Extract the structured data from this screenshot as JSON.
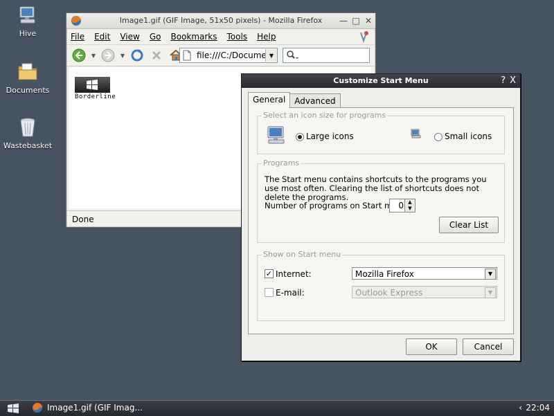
{
  "desktop": {
    "icons": [
      {
        "label": "Hive",
        "icon": "computer-icon"
      },
      {
        "label": "Documents",
        "icon": "folder-icon"
      },
      {
        "label": "Wastebasket",
        "icon": "trash-icon"
      }
    ]
  },
  "firefox": {
    "title": "Image1.gif (GIF Image, 51x50 pixels) - Mozilla Firefox",
    "menu": [
      "File",
      "Edit",
      "View",
      "Go",
      "Bookmarks",
      "Tools",
      "Help"
    ],
    "url": "file:///C:/Documents",
    "image_caption": "Borderline",
    "status": "Done"
  },
  "dialog": {
    "title": "Customize Start Menu",
    "title_help": "?",
    "title_close": "X",
    "tabs": [
      "General",
      "Advanced"
    ],
    "icon_size": {
      "legend": "Select an icon size for programs",
      "large": "Large icons",
      "small": "Small icons",
      "selected": "large"
    },
    "programs": {
      "legend": "Programs",
      "desc": "The Start menu contains shortcuts to the programs you use most often. Clearing the list of shortcuts does not delete the programs.",
      "count_label": "Number of programs on Start menu:",
      "count_value": "0",
      "clear_button": "Clear List"
    },
    "show": {
      "legend": "Show on Start menu",
      "internet_label": "Internet:",
      "internet_checked": true,
      "internet_value": "Mozilla Firefox",
      "email_label": "E-mail:",
      "email_checked": false,
      "email_value": "Outlook Express"
    },
    "ok": "OK",
    "cancel": "Cancel"
  },
  "taskbar": {
    "task_label": "Image1.gif (GIF Imag...",
    "tray_arrow": "‹",
    "clock": "22:04"
  },
  "colors": {
    "desktop": "#475361",
    "dialog_title": "#2a2c30"
  }
}
